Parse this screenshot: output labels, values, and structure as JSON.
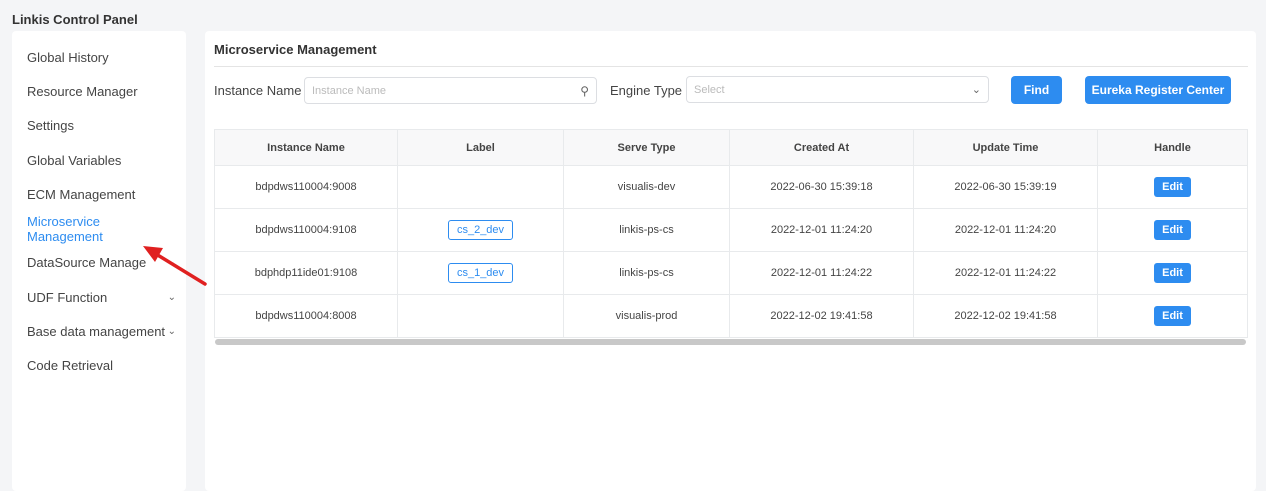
{
  "app_title": "Linkis Control Panel",
  "sidebar": {
    "items": [
      {
        "label": "Global History",
        "active": false,
        "expandable": false
      },
      {
        "label": "Resource Manager",
        "active": false,
        "expandable": false
      },
      {
        "label": "Settings",
        "active": false,
        "expandable": false
      },
      {
        "label": "Global Variables",
        "active": false,
        "expandable": false
      },
      {
        "label": "ECM Management",
        "active": false,
        "expandable": false
      },
      {
        "label": "Microservice Management",
        "active": true,
        "expandable": false
      },
      {
        "label": "DataSource Manage",
        "active": false,
        "expandable": true
      },
      {
        "label": "UDF Function",
        "active": false,
        "expandable": true
      },
      {
        "label": "Base data management",
        "active": false,
        "expandable": true
      },
      {
        "label": "Code Retrieval",
        "active": false,
        "expandable": false
      }
    ]
  },
  "main": {
    "title": "Microservice Management",
    "filters": {
      "instance_label": "Instance Name",
      "instance_placeholder": "Instance Name",
      "engine_label": "Engine Type",
      "engine_placeholder": "Select"
    },
    "find_label": "Find",
    "eureka_label": "Eureka Register Center",
    "table": {
      "columns": [
        "Instance Name",
        "Label",
        "Serve Type",
        "Created At",
        "Update Time",
        "Handle"
      ],
      "rows": [
        {
          "instance": "bdpdws110004:9008",
          "label": "",
          "serve_type": "visualis-dev",
          "created": "2022-06-30 15:39:18",
          "updated": "2022-06-30 15:39:19",
          "action": "Edit"
        },
        {
          "instance": "bdpdws110004:9108",
          "label": "cs_2_dev",
          "serve_type": "linkis-ps-cs",
          "created": "2022-12-01 11:24:20",
          "updated": "2022-12-01 11:24:20",
          "action": "Edit"
        },
        {
          "instance": "bdphdp11ide01:9108",
          "label": "cs_1_dev",
          "serve_type": "linkis-ps-cs",
          "created": "2022-12-01 11:24:22",
          "updated": "2022-12-01 11:24:22",
          "action": "Edit"
        },
        {
          "instance": "bdpdws110004:8008",
          "label": "",
          "serve_type": "visualis-prod",
          "created": "2022-12-02 19:41:58",
          "updated": "2022-12-02 19:41:58",
          "action": "Edit"
        }
      ]
    }
  },
  "colors": {
    "accent": "#2d8cf0",
    "annotation_arrow": "#e02020"
  }
}
